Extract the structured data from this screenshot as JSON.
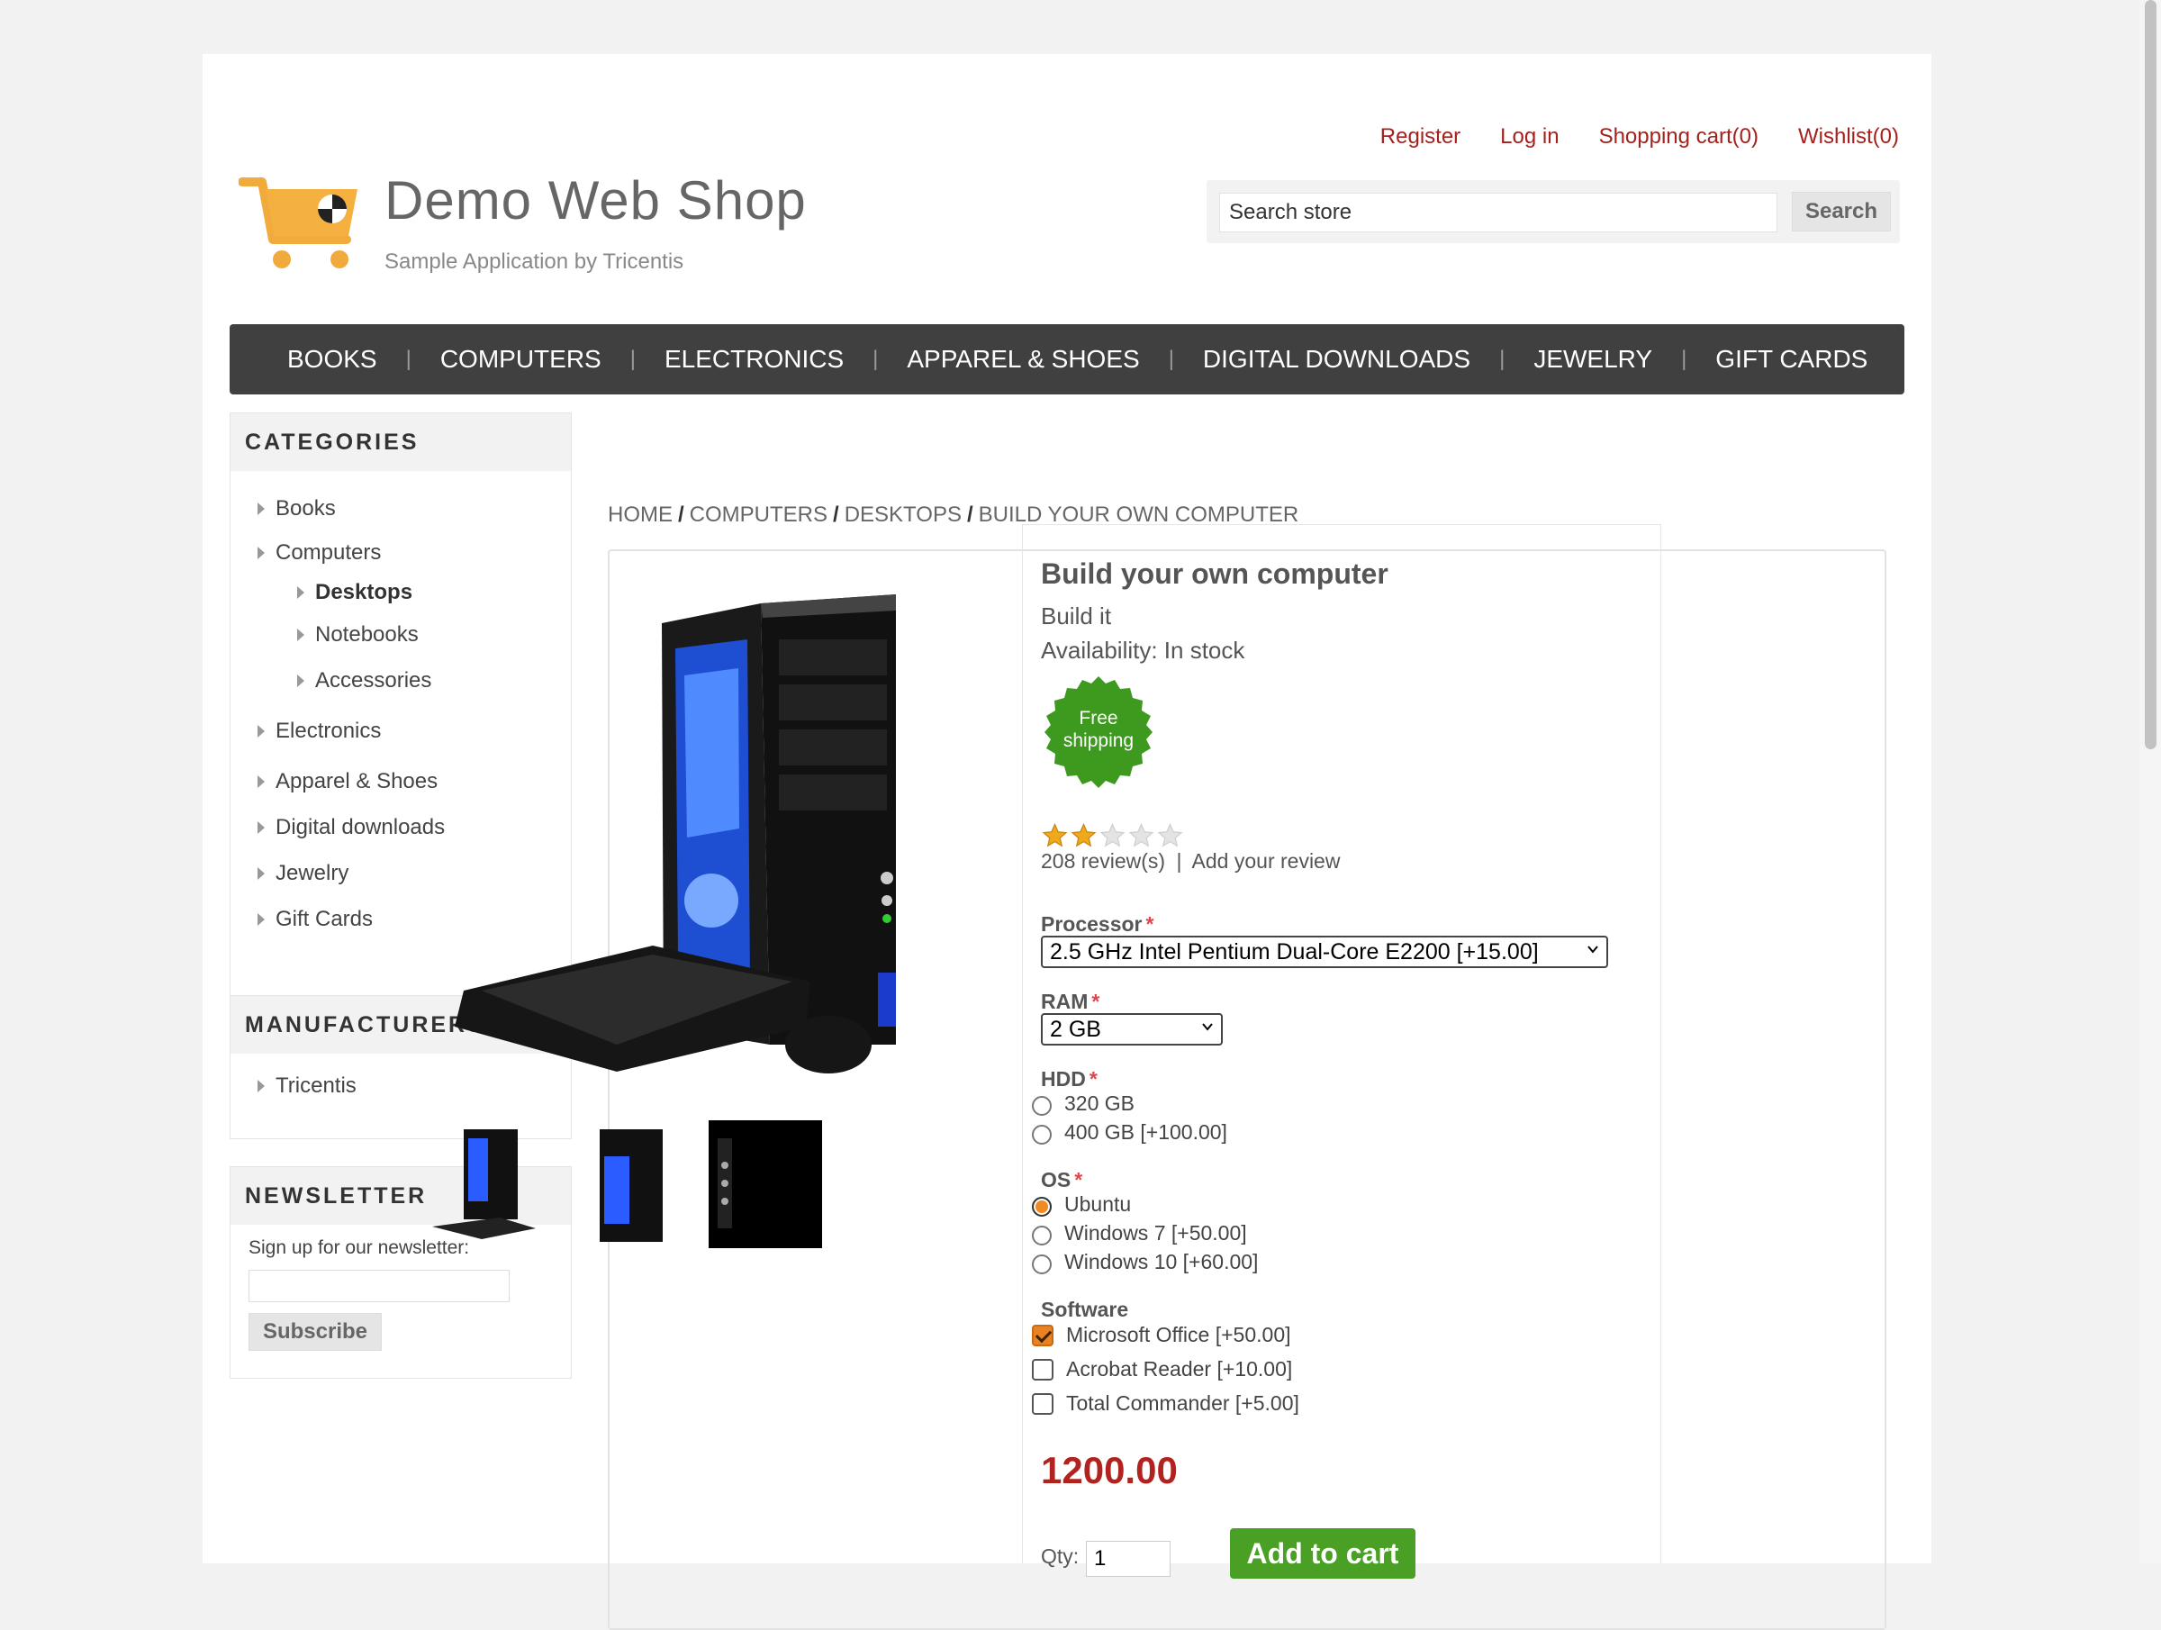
{
  "header": {
    "logo_title": "Demo Web Shop",
    "logo_subtitle": "Sample Application by Tricentis",
    "links": {
      "register": "Register",
      "login": "Log in",
      "cart": "Shopping cart(0)",
      "wishlist": "Wishlist(0)"
    },
    "search": {
      "placeholder": "Search store",
      "button": "Search"
    }
  },
  "nav": {
    "items": [
      "BOOKS",
      "COMPUTERS",
      "ELECTRONICS",
      "APPAREL & SHOES",
      "DIGITAL DOWNLOADS",
      "JEWELRY",
      "GIFT CARDS"
    ]
  },
  "sidebar": {
    "categories": {
      "title": "CATEGORIES",
      "items": [
        "Books",
        "Computers",
        "Desktops",
        "Notebooks",
        "Accessories",
        "Electronics",
        "Apparel & Shoes",
        "Digital downloads",
        "Jewelry",
        "Gift Cards"
      ]
    },
    "manufacturers": {
      "title": "MANUFACTURERS",
      "items": [
        "Tricentis"
      ]
    },
    "newsletter": {
      "title": "NEWSLETTER",
      "label": "Sign up for our newsletter:",
      "button": "Subscribe"
    }
  },
  "breadcrumb": [
    "HOME",
    "COMPUTERS",
    "DESKTOPS",
    "BUILD YOUR OWN COMPUTER"
  ],
  "product": {
    "name": "Build your own computer",
    "short": "Build it",
    "availability": "Availability: In stock",
    "badge": {
      "line1": "Free",
      "line2": "shipping"
    },
    "rating_stars": 2,
    "rating_max": 5,
    "reviews": "208 review(s)",
    "review_sep": "|",
    "add_review": "Add your review",
    "required_mark": "*",
    "processor": {
      "label": "Processor",
      "value": "2.5 GHz Intel Pentium Dual-Core E2200 [+15.00]"
    },
    "ram": {
      "label": "RAM",
      "value": "2 GB"
    },
    "hdd": {
      "label": "HDD",
      "options": [
        "320 GB",
        "400 GB [+100.00]"
      ]
    },
    "os": {
      "label": "OS",
      "options": [
        "Ubuntu",
        "Windows 7 [+50.00]",
        "Windows 10 [+60.00]"
      ],
      "selected": 0
    },
    "software": {
      "label": "Software",
      "options": [
        "Microsoft Office [+50.00]",
        "Acrobat Reader [+10.00]",
        "Total Commander [+5.00]"
      ],
      "checked": [
        true,
        false,
        false
      ]
    },
    "price": "1200.00",
    "qty_label": "Qty:",
    "qty_value": "1",
    "add_to_cart": "Add to cart"
  },
  "colors": {
    "brand_red": "#a4211d",
    "nav_bg": "#404040",
    "badge_green": "#3d9a1f",
    "price_red": "#b2231f",
    "cart_green": "#4a9f25"
  }
}
